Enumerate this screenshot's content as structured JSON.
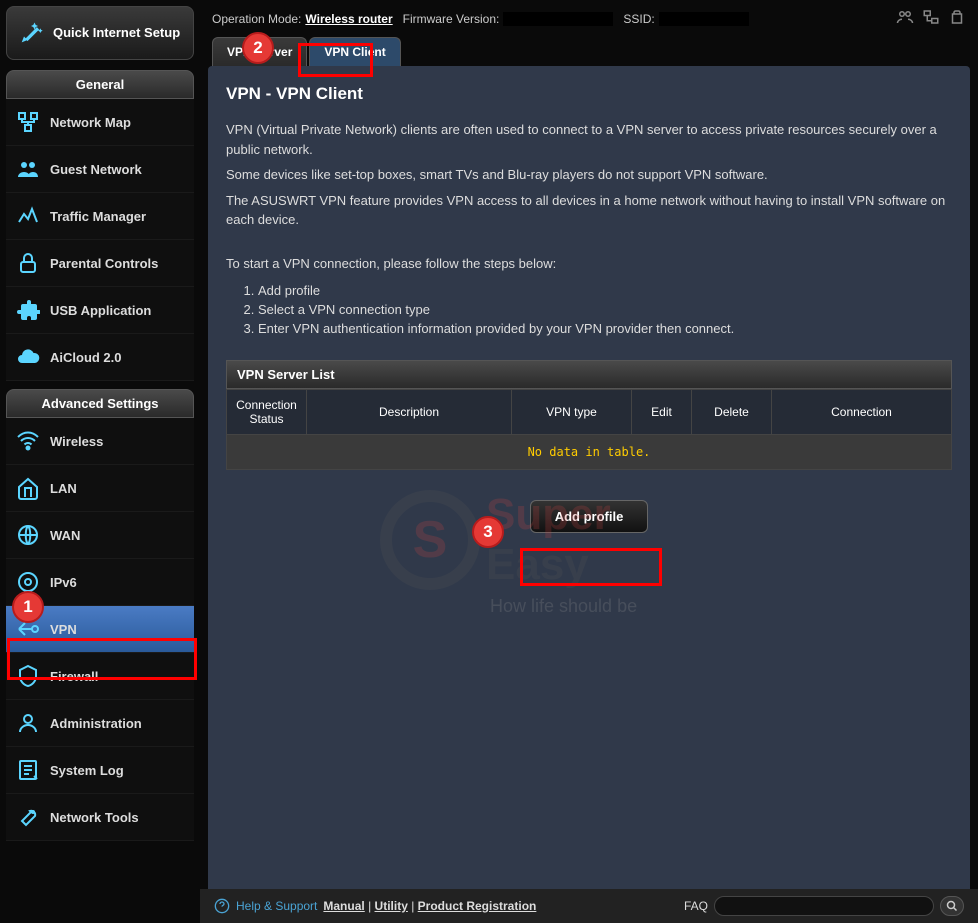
{
  "topbar": {
    "mode_label": "Operation Mode:",
    "mode_value": "Wireless router",
    "firmware_label": "Firmware Version:",
    "ssid_label": "SSID:"
  },
  "qis": {
    "label": "Quick Internet Setup"
  },
  "sections": {
    "general": "General",
    "advanced": "Advanced Settings"
  },
  "nav_general": [
    {
      "label": "Network Map",
      "icon": "network-map-icon"
    },
    {
      "label": "Guest Network",
      "icon": "guest-network-icon"
    },
    {
      "label": "Traffic Manager",
      "icon": "traffic-icon"
    },
    {
      "label": "Parental Controls",
      "icon": "lock-icon"
    },
    {
      "label": "USB Application",
      "icon": "puzzle-icon"
    },
    {
      "label": "AiCloud 2.0",
      "icon": "cloud-icon"
    }
  ],
  "nav_advanced": [
    {
      "label": "Wireless",
      "icon": "wifi-icon"
    },
    {
      "label": "LAN",
      "icon": "home-icon"
    },
    {
      "label": "WAN",
      "icon": "globe-icon"
    },
    {
      "label": "IPv6",
      "icon": "circle-icon"
    },
    {
      "label": "VPN",
      "icon": "vpn-icon",
      "selected": true
    },
    {
      "label": "Firewall",
      "icon": "shield-icon"
    },
    {
      "label": "Administration",
      "icon": "person-icon"
    },
    {
      "label": "System Log",
      "icon": "log-icon"
    },
    {
      "label": "Network Tools",
      "icon": "wrench-icon"
    }
  ],
  "tabs": [
    {
      "label": "VPN Server",
      "active": false
    },
    {
      "label": "VPN Client",
      "active": true
    }
  ],
  "page": {
    "title": "VPN - VPN Client",
    "p1": "VPN (Virtual Private Network) clients are often used to connect to a VPN server to access private resources securely over a public network.",
    "p2": "Some devices like set-top boxes, smart TVs and Blu-ray players do not support VPN software.",
    "p3": "The ASUSWRT VPN feature provides VPN access to all devices in a home network without having to install VPN software on each device.",
    "steps_intro": "To start a VPN connection, please follow the steps below:",
    "steps": [
      "Add profile",
      "Select a VPN connection type",
      "Enter VPN authentication information provided by your VPN provider then connect."
    ]
  },
  "table": {
    "title": "VPN Server List",
    "headers": [
      "Connection Status",
      "Description",
      "VPN type",
      "Edit",
      "Delete",
      "Connection"
    ],
    "empty": "No data in table."
  },
  "buttons": {
    "add_profile": "Add profile"
  },
  "footer": {
    "help": "Help & Support",
    "manual": "Manual",
    "utility": "Utility",
    "product_reg": "Product Registration",
    "faq": "FAQ"
  },
  "annotations": {
    "badge1": "1",
    "badge2": "2",
    "badge3": "3"
  },
  "watermark": {
    "line1a": "Super",
    "line1b": "Easy",
    "tagline": "How life should be"
  }
}
